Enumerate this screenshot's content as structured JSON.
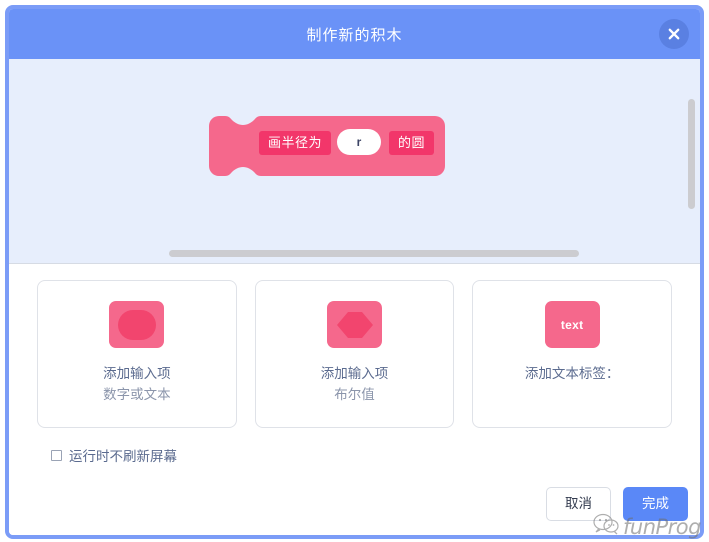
{
  "dialog": {
    "title": "制作新的积木",
    "close_icon": "close-icon"
  },
  "workspace": {
    "block_preview": {
      "label_before": "画半径为",
      "input_value": "r",
      "label_after": "的圆",
      "block_color": "#f2366a",
      "block_outline_color": "#f5688c"
    }
  },
  "options": [
    {
      "icon": "rounded-oval-icon",
      "icon_text": "",
      "title": "添加输入项",
      "subtitle": "数字或文本"
    },
    {
      "icon": "hexagon-icon",
      "icon_text": "",
      "title": "添加输入项",
      "subtitle": "布尔值"
    },
    {
      "icon": "text-label-icon",
      "icon_text": "text",
      "title": "添加文本标签：",
      "subtitle": ""
    }
  ],
  "checkbox": {
    "label": "运行时不刷新屏幕",
    "checked": false
  },
  "footer": {
    "cancel_label": "取消",
    "ok_label": "完成"
  },
  "watermark": {
    "text": "funProg",
    "icon": "wechat-icon"
  },
  "colors": {
    "header_blue": "#6a92f7",
    "workspace_blue": "#e7eefc",
    "accent_pink": "#f2366a",
    "primary_button": "#5a88f7"
  }
}
